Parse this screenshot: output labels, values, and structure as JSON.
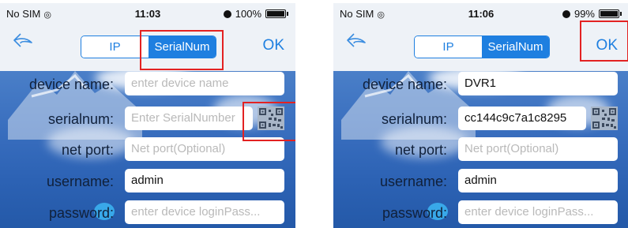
{
  "caption_fragment": "",
  "screens": [
    {
      "status": {
        "carrier": "No SIM",
        "time": "11:03",
        "battery": "100%",
        "battery_level": 1.0
      },
      "nav": {
        "tab_ip": "IP",
        "tab_serial": "SerialNum",
        "ok": "OK"
      },
      "form": {
        "device_name": {
          "label": "device name:",
          "placeholder": "enter device name",
          "value": ""
        },
        "serialnum": {
          "label": "serialnum:",
          "placeholder": "Enter SerialNumber",
          "value": ""
        },
        "net_port": {
          "label": "net port:",
          "placeholder": "Net port(Optional)",
          "value": ""
        },
        "username": {
          "label": "username:",
          "placeholder": "",
          "value": "admin"
        },
        "password": {
          "label": "password:",
          "placeholder": "enter device loginPass...",
          "value": ""
        }
      }
    },
    {
      "status": {
        "carrier": "No SIM",
        "time": "11:06",
        "battery": "99%",
        "battery_level": 0.99
      },
      "nav": {
        "tab_ip": "IP",
        "tab_serial": "SerialNum",
        "ok": "OK"
      },
      "form": {
        "device_name": {
          "label": "device name:",
          "placeholder": "",
          "value": "DVR1"
        },
        "serialnum": {
          "label": "serialnum:",
          "placeholder": "",
          "value": "cc144c9c7a1c8295"
        },
        "net_port": {
          "label": "net port:",
          "placeholder": "Net port(Optional)",
          "value": ""
        },
        "username": {
          "label": "username:",
          "placeholder": "",
          "value": "admin"
        },
        "password": {
          "label": "password:",
          "placeholder": "enter device loginPass...",
          "value": ""
        }
      }
    }
  ],
  "colors": {
    "accent": "#1e7fe0",
    "highlight": "#e32222",
    "background": "#3a6fbf"
  },
  "icons": [
    "back-arrow-icon",
    "qr-code-icon",
    "alarm-icon",
    "battery-icon",
    "wifi-icon"
  ]
}
